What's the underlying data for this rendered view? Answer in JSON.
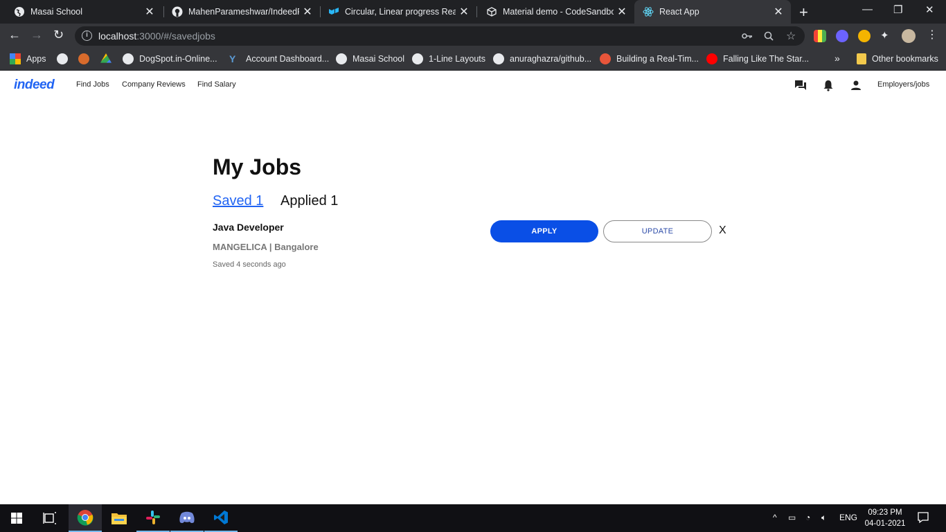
{
  "browser": {
    "tabs": [
      {
        "title": "Masai School",
        "icon": "globe-icon"
      },
      {
        "title": "MahenParameshwar/IndeedRe",
        "icon": "github-icon"
      },
      {
        "title": "Circular, Linear progress React",
        "icon": "material-ui-icon"
      },
      {
        "title": "Material demo - CodeSandbox",
        "icon": "codesandbox-icon"
      },
      {
        "title": "React App",
        "icon": "react-icon",
        "active": true
      }
    ],
    "url_host": "localhost",
    "url_rest": ":3000/#/savedjobs",
    "bookmarks": [
      {
        "label": "Apps",
        "icon": "apps-grid-icon"
      },
      {
        "label": "",
        "icon": "globe-icon"
      },
      {
        "label": "",
        "icon": "figure-icon"
      },
      {
        "label": "",
        "icon": "drive-icon"
      },
      {
        "label": "DogSpot.in-Online...",
        "icon": "globe-icon"
      },
      {
        "label": "Account Dashboard...",
        "icon": "y-logo-icon"
      },
      {
        "label": "Masai School",
        "icon": "globe-icon"
      },
      {
        "label": "1-Line Layouts",
        "icon": "globe-icon"
      },
      {
        "label": "anuraghazra/github...",
        "icon": "github-icon"
      },
      {
        "label": "Building a Real-Tim...",
        "icon": "basketball-icon"
      },
      {
        "label": "Falling Like The Star...",
        "icon": "youtube-icon"
      }
    ],
    "other_bookmarks": "Other bookmarks"
  },
  "site": {
    "logo": "indeed",
    "nav": [
      "Find Jobs",
      "Company Reviews",
      "Find Salary"
    ],
    "employers": "Employers/jobs",
    "brand_color": "#2164f3"
  },
  "main": {
    "title": "My Jobs",
    "tab_saved": "Saved 1",
    "tab_applied": "Applied 1",
    "job": {
      "title": "Java Developer",
      "company": "MANGELICA | Bangalore",
      "saved_time": "Saved 4 seconds ago",
      "apply_label": "APPLY",
      "update_label": "UPDATE",
      "remove_label": "X"
    }
  },
  "taskbar": {
    "lang": "ENG",
    "time": "09:23 PM",
    "date": "04-01-2021"
  }
}
